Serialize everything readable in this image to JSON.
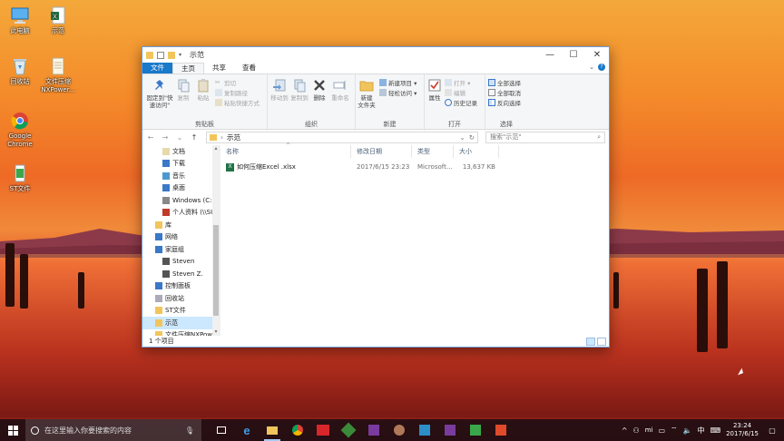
{
  "desktop": {
    "icons": [
      {
        "label": "此电脑",
        "icon": "computer-icon"
      },
      {
        "label": "示范",
        "icon": "excel-file-icon"
      },
      {
        "label": "回收站",
        "icon": "recycle-bin-icon"
      },
      {
        "label": "文件压缩\nNXPower...",
        "icon": "document-icon"
      },
      {
        "label": "Google\nChrome",
        "icon": "chrome-icon"
      },
      {
        "label": "ST文件",
        "icon": "st-file-icon"
      }
    ]
  },
  "window": {
    "title": "示范",
    "tabs": {
      "file": "文件",
      "home": "主页",
      "share": "共享",
      "view": "查看"
    },
    "ribbon": {
      "pin": "固定到\"快速访问\"",
      "copy": "复制",
      "paste": "粘贴",
      "cut": "剪切",
      "copy_path": "复制路径",
      "paste_shortcut": "粘贴快捷方式",
      "clipboard": "剪贴板",
      "move_to": "移动到",
      "copy_to": "复制到",
      "delete": "删除",
      "rename": "重命名",
      "organize": "组织",
      "new_folder": "新建\n文件夹",
      "new_item": "新建项目 ▾",
      "easy_access": "轻松访问 ▾",
      "new": "新建",
      "properties": "属性",
      "open": "打开 ▾",
      "edit": "编辑",
      "history": "历史记录",
      "open_group": "打开",
      "select_all": "全部选择",
      "select_none": "全部取消",
      "invert_selection": "反向选择",
      "select": "选择"
    },
    "address": {
      "path": "示范",
      "search_placeholder": "搜索\"示范\""
    },
    "nav": [
      {
        "label": "文档",
        "icon": "documents-icon",
        "indent": 2
      },
      {
        "label": "下载",
        "icon": "downloads-icon",
        "indent": 2
      },
      {
        "label": "音乐",
        "icon": "music-icon",
        "indent": 2
      },
      {
        "label": "桌面",
        "icon": "desktop-folder-icon",
        "indent": 2
      },
      {
        "label": "Windows (C:)",
        "icon": "drive-icon",
        "indent": 2
      },
      {
        "label": "个人资料 (\\\\SU",
        "icon": "network-drive-icon",
        "indent": 2
      },
      {
        "label": "库",
        "icon": "library-icon",
        "indent": 1
      },
      {
        "label": "网络",
        "icon": "network-icon",
        "indent": 1
      },
      {
        "label": "家庭组",
        "icon": "homegroup-icon",
        "indent": 1
      },
      {
        "label": "Steven",
        "icon": "user-folder-icon",
        "indent": 2
      },
      {
        "label": "Steven Z.",
        "icon": "user-folder-icon",
        "indent": 2
      },
      {
        "label": "控制面板",
        "icon": "control-panel-icon",
        "indent": 1
      },
      {
        "label": "回收站",
        "icon": "recycle-bin-icon",
        "indent": 1
      },
      {
        "label": "ST文件",
        "icon": "folder-icon",
        "indent": 1
      },
      {
        "label": "示范",
        "icon": "folder-icon",
        "indent": 1,
        "selected": true
      },
      {
        "label": "文件压缩NXPow",
        "icon": "folder-icon",
        "indent": 1
      }
    ],
    "columns": {
      "name": "名称",
      "modified": "修改日期",
      "type": "类型",
      "size": "大小"
    },
    "files": [
      {
        "name": "如何压缩Excel .xlsx",
        "modified": "2017/6/15 23:23",
        "type": "Microsoft...",
        "size": "13,637 KB"
      }
    ],
    "status": "1 个项目"
  },
  "taskbar": {
    "search_placeholder": "在这里输入你要搜索的内容",
    "ime": "中",
    "time": "23:24",
    "date": "2017/6/15"
  }
}
